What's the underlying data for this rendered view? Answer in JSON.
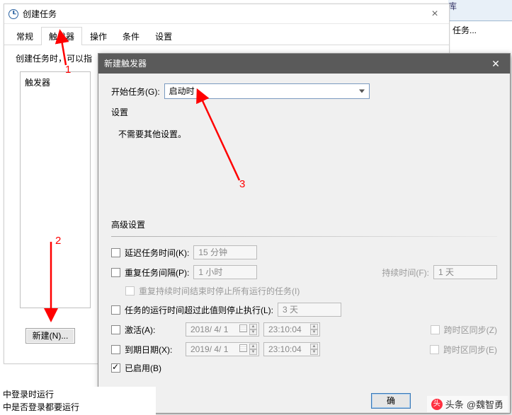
{
  "bg_tab": "库",
  "bg_text": "任务...",
  "parent": {
    "title": "创建任务",
    "tabs": [
      "常规",
      "触发器",
      "操作",
      "条件",
      "设置"
    ],
    "active_tab": 1,
    "hint": "创建任务时，可以指",
    "list_header": "触发器",
    "new_btn": "新建(N)..."
  },
  "child": {
    "title": "新建触发器",
    "start_label": "开始任务(G):",
    "start_value": "启动时",
    "settings_label": "设置",
    "settings_info": "不需要其他设置。",
    "advanced_label": "高级设置",
    "delay_label": "延迟任务时间(K):",
    "delay_value": "15 分钟",
    "repeat_label": "重复任务间隔(P):",
    "repeat_value": "1 小时",
    "duration_label": "持续时间(F):",
    "duration_value": "1 天",
    "repeat_stop_label": "重复持续时间结束时停止所有运行的任务(I)",
    "stop_if_label": "任务的运行时间超过此值则停止执行(L):",
    "stop_if_value": "3 天",
    "activate_label": "激活(A):",
    "activate_date": "2018/ 4/ 1",
    "activate_time": "23:10:04",
    "activate_tz": "跨时区同步(Z)",
    "expire_label": "到期日期(X):",
    "expire_date": "2019/ 4/ 1",
    "expire_time": "23:10:04",
    "expire_tz": "跨时区同步(E)",
    "enabled_label": "已启用(B)",
    "ok": "确"
  },
  "bottom1": "中登录时运行",
  "bottom2": "中是否登录都要运行",
  "watermark_prefix": "头条",
  "watermark_user": "@魏智勇",
  "annot": {
    "n1": "1",
    "n2": "2",
    "n3": "3"
  }
}
